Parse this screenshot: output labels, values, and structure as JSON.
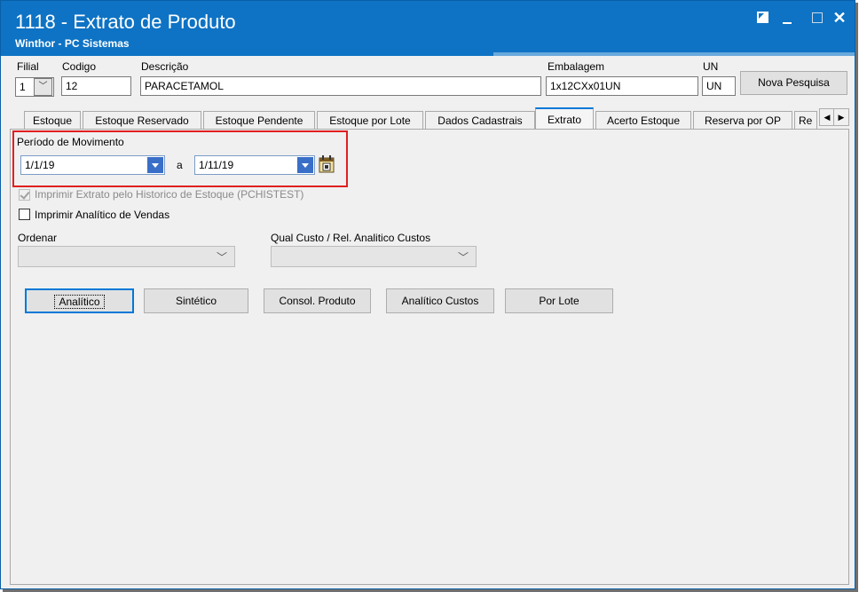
{
  "window": {
    "title": "1118 - Extrato de Produto",
    "subtitle": "Winthor - PC Sistemas",
    "close_glyph": "✕"
  },
  "header": {
    "filial_label": "Filial",
    "filial_value": "1",
    "codigo_label": "Codigo",
    "codigo_value": "12",
    "descricao_label": "Descrição",
    "descricao_value": "PARACETAMOL",
    "embalagem_label": "Embalagem",
    "embalagem_value": "1x12CXx01UN",
    "un_label": "UN",
    "un_value": "UN",
    "nova_pesquisa_label": "Nova Pesquisa"
  },
  "tabs": [
    {
      "label": "Estoque"
    },
    {
      "label": "Estoque Reservado"
    },
    {
      "label": "Estoque Pendente"
    },
    {
      "label": "Estoque por Lote"
    },
    {
      "label": "Dados Cadastrais"
    },
    {
      "label": "Extrato"
    },
    {
      "label": "Acerto Estoque"
    },
    {
      "label": "Reserva por OP"
    },
    {
      "label": "Re"
    }
  ],
  "active_tab": "Extrato",
  "extrato": {
    "periodo_label": "Período de Movimento",
    "data_inicio": "1/1/19",
    "separador": "a",
    "data_fim": "1/11/19",
    "imprimir_historico_label": "Imprimir Extrato pelo Historico de Estoque (PCHISTEST)",
    "imprimir_analitico_label": "Imprimir Analítico de Vendas",
    "ordenar_label": "Ordenar",
    "qual_custo_label": "Qual Custo / Rel. Analitico Custos",
    "buttons": {
      "analitico": "Analítico",
      "sintetico": "Sintético",
      "consol_produto": "Consol. Produto",
      "analitico_custos": "Analítico Custos",
      "por_lote": "Por Lote"
    }
  },
  "colors": {
    "titlebar": "#0e73c4",
    "highlight_box": "#e02020",
    "accent": "#0078d7"
  }
}
